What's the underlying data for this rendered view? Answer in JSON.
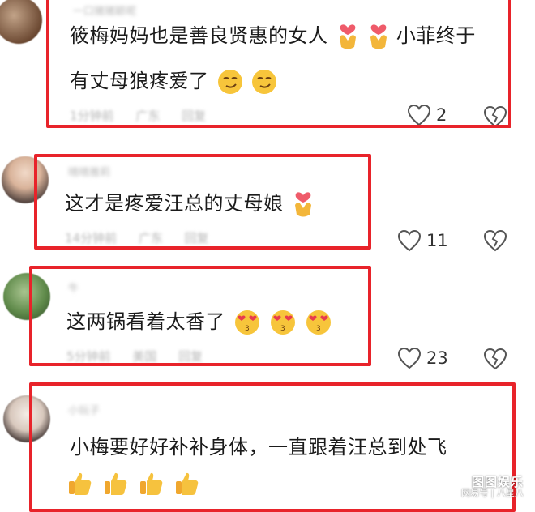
{
  "comments": [
    {
      "username": "一口猪猪颖呢",
      "text_line1": "筱梅妈妈也是善良贤惠的女人",
      "text_line1b": "小菲终于",
      "text_line2": "有丈母狼疼爱了",
      "time": "1分钟前",
      "location": "广东",
      "reply": "回复",
      "likes": "2"
    },
    {
      "username": "晴晴雅莉",
      "text_line1": "这才是疼爱汪总的丈母娘",
      "time": "14分钟前",
      "location": "广东",
      "reply": "回复",
      "likes": "11"
    },
    {
      "username": "牛",
      "text_line1": "这两锅看着太香了",
      "time": "5分钟前",
      "location": "美国",
      "reply": "回复",
      "likes": "23"
    },
    {
      "username": "小玩子",
      "text_line1": "小梅要好好补补身体，一直跟着汪总到处飞"
    }
  ],
  "watermark": {
    "line1": "图图娱乐",
    "line2": "网易号 | 八星八"
  },
  "colors": {
    "highlight_box": "#e8232a",
    "meta_text": "#b5b5b5"
  },
  "icons": {
    "like": "heart-outline-icon",
    "dislike": "broken-heart-icon",
    "heart_hands": "heart-hands-emoji",
    "smirk": "smirk-emoji",
    "heart_eyes": "heart-eyes-kiss-emoji",
    "thumbs_up": "thumbs-up-emoji"
  }
}
